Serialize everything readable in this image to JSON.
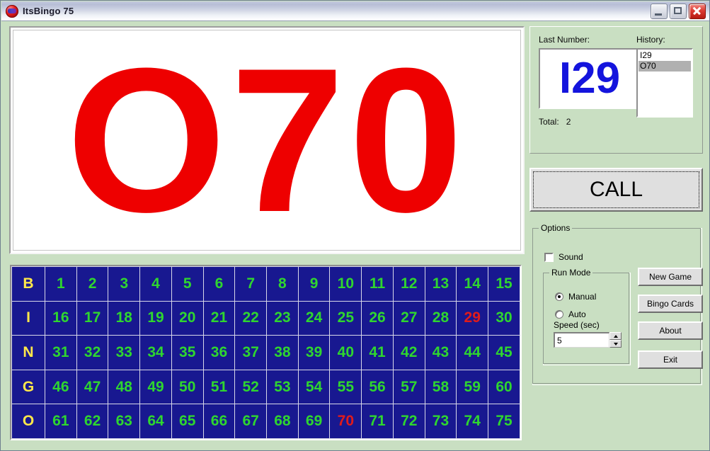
{
  "window": {
    "title": "ItsBingo 75",
    "icon": "bingo-ball-icon",
    "controls": {
      "minimize": "minimize-button",
      "maximize": "maximize-button",
      "close": "close-button"
    }
  },
  "display": {
    "current_call": "O70",
    "text_color": "#ee0000",
    "background": "#ffffff"
  },
  "status": {
    "last_number_label": "Last Number:",
    "last_number": "I29",
    "last_number_color": "#1414dd",
    "history_label": "History:",
    "history": [
      {
        "value": "I29",
        "selected": false
      },
      {
        "value": "O70",
        "selected": true
      }
    ],
    "total_label": "Total:",
    "total_value": "2"
  },
  "call_button": {
    "label": "CALL",
    "focused": true
  },
  "options": {
    "title": "Options",
    "sound": {
      "label": "Sound",
      "checked": false
    },
    "run_mode": {
      "title": "Run Mode",
      "options": [
        {
          "label": "Manual",
          "selected": true
        },
        {
          "label": "Auto",
          "selected": false
        }
      ]
    },
    "speed": {
      "label": "Speed (sec)",
      "value": "5"
    },
    "buttons": [
      {
        "label": "New Game"
      },
      {
        "label": "Bingo Cards"
      },
      {
        "label": "About"
      },
      {
        "label": "Exit"
      }
    ]
  },
  "board": {
    "letter_color": "#ffe84a",
    "number_color": "#2fd62f",
    "called_color": "#e01b1b",
    "cell_background": "#181890",
    "called_numbers": [
      29,
      70
    ],
    "rows": [
      {
        "letter": "B",
        "numbers": [
          1,
          2,
          3,
          4,
          5,
          6,
          7,
          8,
          9,
          10,
          11,
          12,
          13,
          14,
          15
        ]
      },
      {
        "letter": "I",
        "numbers": [
          16,
          17,
          18,
          19,
          20,
          21,
          22,
          23,
          24,
          25,
          26,
          27,
          28,
          29,
          30
        ]
      },
      {
        "letter": "N",
        "numbers": [
          31,
          32,
          33,
          34,
          35,
          36,
          37,
          38,
          39,
          40,
          41,
          42,
          43,
          44,
          45
        ]
      },
      {
        "letter": "G",
        "numbers": [
          46,
          47,
          48,
          49,
          50,
          51,
          52,
          53,
          54,
          55,
          56,
          57,
          58,
          59,
          60
        ]
      },
      {
        "letter": "O",
        "numbers": [
          61,
          62,
          63,
          64,
          65,
          66,
          67,
          68,
          69,
          70,
          71,
          72,
          73,
          74,
          75
        ]
      }
    ]
  }
}
